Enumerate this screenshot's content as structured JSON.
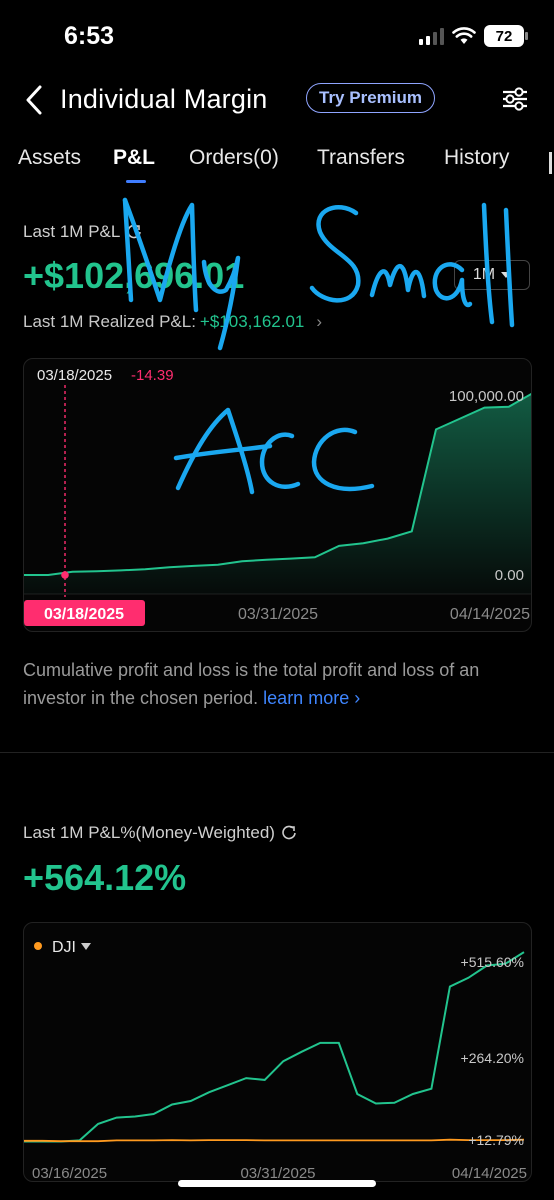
{
  "status_bar": {
    "time": "6:53",
    "battery": "72"
  },
  "header": {
    "title": "Individual Margin",
    "premium_label": "Try Premium"
  },
  "tabs": [
    {
      "label": "Assets",
      "active": false
    },
    {
      "label": "P&L",
      "active": true
    },
    {
      "label": "Orders(0)",
      "active": false
    },
    {
      "label": "Transfers",
      "active": false
    },
    {
      "label": "History",
      "active": false
    }
  ],
  "pnl": {
    "label": "Last 1M P&L",
    "value": "+$102,696.01",
    "period": "1M",
    "realized_label": "Last 1M Realized P&L:",
    "realized_value": "+$103,162.01"
  },
  "chart1_labels": {
    "tooltip_date": "03/18/2025",
    "tooltip_value": "-14.39",
    "y_top": "100,000.00",
    "y_bottom": "0.00",
    "x_start": "03/18/2025",
    "x_mid": "03/31/2025",
    "x_end": "04/14/2025"
  },
  "description": {
    "text": "Cumulative profit and loss is the total profit and loss of an investor in the chosen period.",
    "link": "learn more"
  },
  "pnl_pct": {
    "label": "Last 1M P&L%(Money-Weighted)",
    "value": "+564.12%",
    "benchmark": "DJI"
  },
  "chart2_labels": {
    "y_top": "+515.60%",
    "y_mid": "+264.20%",
    "y_bottom": "+12.79%",
    "x_start": "03/16/2025",
    "x_mid": "03/31/2025",
    "x_end": "04/14/2025"
  },
  "handwriting": {
    "line1": "My Small",
    "line2": "ACC"
  },
  "colors": {
    "positive": "#22c48e",
    "negative": "#ff2d6f",
    "benchmark": "#ff9a1f",
    "link": "#3f86ff",
    "premium": "#a9c0ff",
    "ink": "#1aa8f0"
  },
  "chart_data": [
    {
      "type": "area",
      "y": [
        -14.39,
        0,
        1800,
        2100,
        2500,
        3200,
        4300,
        5000,
        5600,
        7500,
        8400,
        9000,
        9700,
        16000,
        17500,
        20000,
        24000,
        80000,
        86000,
        92000,
        92500,
        100000
      ],
      "x_range": [
        "03/18/2025",
        "04/14/2025"
      ],
      "ylim": [
        0,
        100000
      ]
    },
    {
      "type": "line",
      "series": [
        {
          "values": [
            0,
            0,
            0,
            3,
            50,
            68,
            71,
            78,
            105,
            115,
            140,
            160,
            180,
            175,
            228,
            255,
            280,
            280,
            135,
            108,
            110,
            135,
            150,
            440,
            465,
            500,
            505,
            538
          ]
        },
        {
          "name": "DJI",
          "values": [
            2,
            2,
            1,
            1,
            1,
            3,
            3,
            3,
            4,
            3,
            4,
            4,
            4,
            3,
            3,
            3,
            3,
            3,
            3,
            3,
            3,
            3,
            3,
            5,
            4,
            4,
            4,
            5
          ]
        }
      ],
      "x_range": [
        "03/16/2025",
        "04/14/2025"
      ],
      "ylim": [
        12.79,
        515.6
      ]
    }
  ]
}
